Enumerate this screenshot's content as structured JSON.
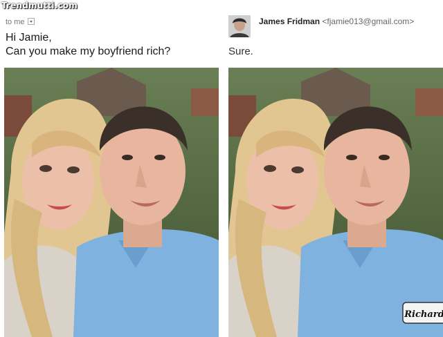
{
  "watermark": "Trendmutti.com",
  "left": {
    "to_label": "to me",
    "message_lines": [
      "Hi Jamie,",
      "Can you make my boyfriend rich?"
    ]
  },
  "right": {
    "sender_name": "James Fridman",
    "sender_email": "<fjamie013@gmail.com>",
    "reply": "Sure."
  },
  "name_tag": "Richard",
  "colors": {
    "shirt": "#7fb2de",
    "hair_blonde": "#e2c692",
    "hair_dark": "#3b3029",
    "skin": "#e8b9a2",
    "foliage": "#4f6b3c"
  }
}
